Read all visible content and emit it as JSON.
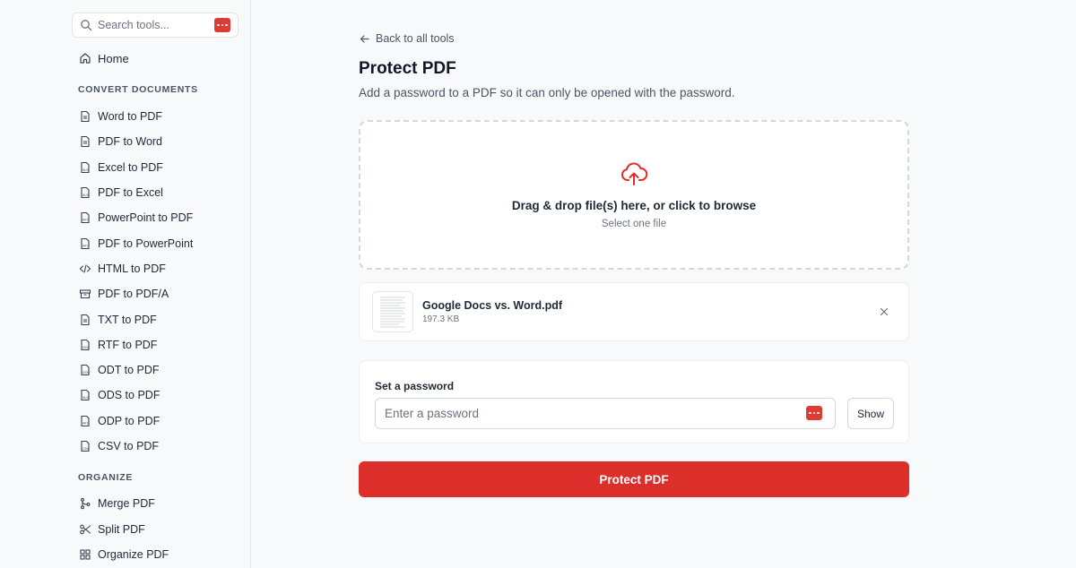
{
  "sidebar": {
    "search": {
      "placeholder": "Search tools..."
    },
    "home_label": "Home",
    "sections": [
      {
        "title": "CONVERT DOCUMENTS",
        "items": [
          {
            "label": "Word to PDF",
            "icon": "file-text-icon"
          },
          {
            "label": "PDF to Word",
            "icon": "file-text-icon"
          },
          {
            "label": "Excel to PDF",
            "icon": "file-xls-icon"
          },
          {
            "label": "PDF to Excel",
            "icon": "file-xls-icon"
          },
          {
            "label": "PowerPoint to PDF",
            "icon": "file-ppt-icon"
          },
          {
            "label": "PDF to PowerPoint",
            "icon": "file-ppt-icon"
          },
          {
            "label": "HTML to PDF",
            "icon": "code-icon"
          },
          {
            "label": "PDF to PDF/A",
            "icon": "archive-icon"
          },
          {
            "label": "TXT to PDF",
            "icon": "file-text-icon"
          },
          {
            "label": "RTF to PDF",
            "icon": "file-doc-icon"
          },
          {
            "label": "ODT to PDF",
            "icon": "file-doc-icon"
          },
          {
            "label": "ODS to PDF",
            "icon": "file-xls-icon"
          },
          {
            "label": "ODP to PDF",
            "icon": "file-ppt-icon"
          },
          {
            "label": "CSV to PDF",
            "icon": "file-csv-icon"
          }
        ]
      },
      {
        "title": "ORGANIZE",
        "items": [
          {
            "label": "Merge PDF",
            "icon": "merge-icon"
          },
          {
            "label": "Split PDF",
            "icon": "scissors-icon"
          },
          {
            "label": "Organize PDF",
            "icon": "grid-icon"
          }
        ]
      }
    ]
  },
  "main": {
    "back_label": "Back to all tools",
    "title": "Protect PDF",
    "subtitle": "Add a password to a PDF so it can only be opened with the password.",
    "dropzone": {
      "title": "Drag & drop file(s) here, or click to browse",
      "hint": "Select one file"
    },
    "file": {
      "name": "Google Docs vs. Word.pdf",
      "size": "197.3 KB"
    },
    "password": {
      "label": "Set a password",
      "placeholder": "Enter a password",
      "show_label": "Show"
    },
    "submit_label": "Protect PDF"
  },
  "colors": {
    "accent": "#dc2f2b",
    "background": "#f8f9fb",
    "card": "#ffffff"
  }
}
